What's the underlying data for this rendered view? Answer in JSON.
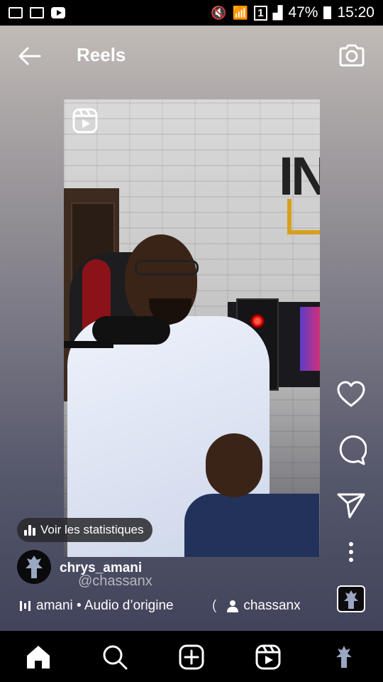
{
  "status_bar": {
    "battery_percent": "47%",
    "time": "15:20",
    "sim_indicator": "1"
  },
  "header": {
    "title": "Reels",
    "back_icon": "arrow-left-icon",
    "camera_icon": "camera-icon"
  },
  "video": {
    "reel_icon": "reels-icon",
    "logo_text": "IN"
  },
  "stats": {
    "label": "Voir les statistiques"
  },
  "actions": {
    "like_icon": "heart-icon",
    "comment_icon": "comment-icon",
    "share_icon": "send-icon",
    "more_icon": "more-vertical-icon"
  },
  "post": {
    "username": "chrys_amani",
    "watermark": "@chassanx",
    "audio_text": "amani • Audio d’origine",
    "audio_paren": "(",
    "tagged_user": "chassanx"
  },
  "bottom_nav": {
    "items": [
      "home-icon",
      "search-icon",
      "create-icon",
      "reels-icon",
      "profile-avatar"
    ]
  },
  "colors": {
    "accent_red": "#8b1218",
    "bar_black": "#000000",
    "white": "#ffffff"
  }
}
